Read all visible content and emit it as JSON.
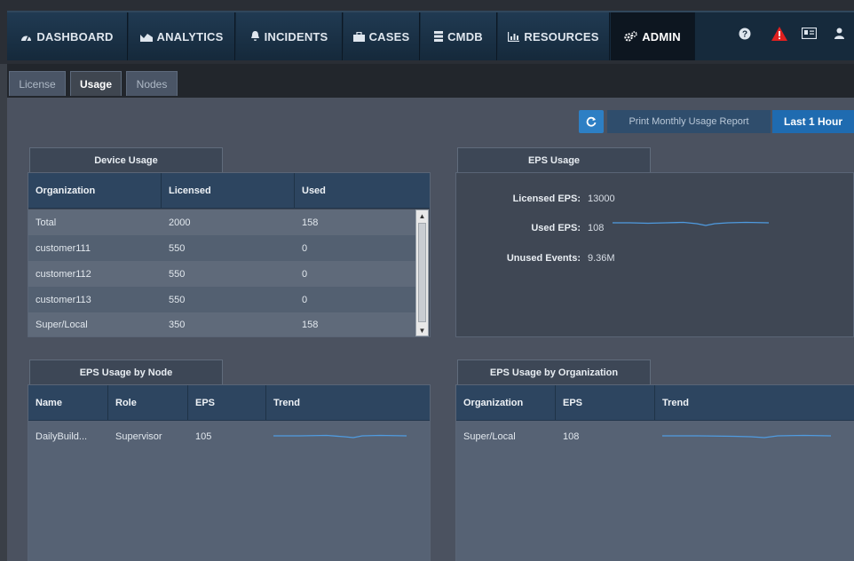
{
  "topnav": {
    "tabs": [
      {
        "label": "DASHBOARD",
        "icon": "dashboard-icon"
      },
      {
        "label": "ANALYTICS",
        "icon": "analytics-icon"
      },
      {
        "label": "INCIDENTS",
        "icon": "bell-icon"
      },
      {
        "label": "CASES",
        "icon": "briefcase-icon"
      },
      {
        "label": "CMDB",
        "icon": "database-icon"
      },
      {
        "label": "RESOURCES",
        "icon": "bar-chart-icon"
      },
      {
        "label": "ADMIN",
        "icon": "gears-icon"
      }
    ],
    "active": "ADMIN",
    "right_icons": [
      "help-icon",
      "alert-icon",
      "id-card-icon",
      "user-icon"
    ],
    "alert_color": "#e0201f"
  },
  "subtabs": [
    "License",
    "Usage",
    "Nodes"
  ],
  "active_subtab": "Usage",
  "toolbar": {
    "refresh_icon": "refresh-icon",
    "print_label": "Print Monthly Usage Report",
    "period_label": "Last 1 Hour"
  },
  "device_usage": {
    "title": "Device Usage",
    "columns": [
      "Organization",
      "Licensed",
      "Used"
    ],
    "rows": [
      [
        "Total",
        "2000",
        "158"
      ],
      [
        "customer111",
        "550",
        "0"
      ],
      [
        "customer112",
        "550",
        "0"
      ],
      [
        "customer113",
        "550",
        "0"
      ],
      [
        "Super/Local",
        "350",
        "158"
      ]
    ]
  },
  "eps_usage": {
    "title": "EPS Usage",
    "licensed_label": "Licensed EPS:",
    "licensed_value": "13000",
    "used_label": "Used EPS:",
    "used_value": "108",
    "unused_label": "Unused Events:",
    "unused_value": "9.36M"
  },
  "eps_by_node": {
    "title": "EPS Usage by Node",
    "columns": [
      "Name",
      "Role",
      "EPS",
      "Trend"
    ],
    "rows": [
      [
        "DailyBuild...",
        "Supervisor",
        "105"
      ]
    ]
  },
  "eps_by_org": {
    "title": "EPS Usage by Organization",
    "columns": [
      "Organization",
      "EPS",
      "Trend"
    ],
    "rows": [
      [
        "Super/Local",
        "108"
      ]
    ]
  },
  "colors": {
    "nav_bg": "#162a3c",
    "accent_blue": "#1f6bb0",
    "sparkline": "#4f9be0"
  }
}
